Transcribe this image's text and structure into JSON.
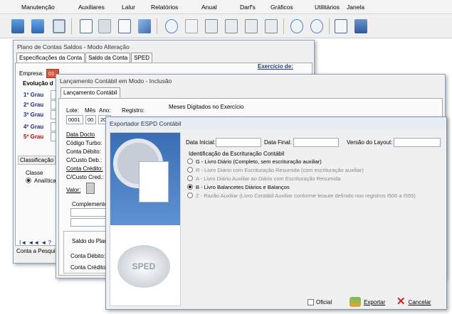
{
  "menu": [
    {
      "label": "Manutenção"
    },
    {
      "label": "Auxiliares"
    },
    {
      "label": "Lalur"
    },
    {
      "label": "Relatórios"
    },
    {
      "label": "Anual"
    },
    {
      "label": "Darf's"
    },
    {
      "label": "Gráficos"
    },
    {
      "label": "Utilitários"
    },
    {
      "label": "Janela"
    }
  ],
  "toolbar": [
    {
      "icon": "import-icon",
      "color": "#3f78c4"
    },
    {
      "icon": "users-icon",
      "color": "#3f78c4"
    },
    {
      "icon": "window-icon",
      "color": "#7a8fa8"
    },
    {
      "icon": "document-edit-icon",
      "color": "#4b6fa0"
    },
    {
      "icon": "calculator-icon",
      "color": "#8ea1b6"
    },
    {
      "icon": "percent-icon",
      "color": "#4b6fa0"
    },
    {
      "icon": "pencil-icon",
      "color": "#5c7fb3"
    },
    {
      "icon": "zoom-icon",
      "color": "#5c7fb3"
    },
    {
      "icon": "page-icon",
      "color": "#9aa7b4"
    },
    {
      "icon": "report-icon",
      "color": "#7b8a99"
    },
    {
      "icon": "report-2-icon",
      "color": "#7b8a99"
    },
    {
      "icon": "report-3-icon",
      "color": "#7b8a99"
    },
    {
      "icon": "report-4-icon",
      "color": "#7b8a99"
    },
    {
      "icon": "preview-icon",
      "color": "#5c7fb3"
    },
    {
      "icon": "preview-2-icon",
      "color": "#5c7fb3"
    },
    {
      "icon": "book-icon",
      "color": "#4a6a9e"
    },
    {
      "icon": "exit-icon",
      "color": "#4a6a9e"
    }
  ],
  "plano": {
    "title": "Plano de Contas Saldos - Modo Alteração",
    "tabs": [
      "Especificações da Conta",
      "Saldo da Conta",
      "SPED"
    ],
    "empresa_label": "Empresa:",
    "empresa_value": "01",
    "evolucao_label": "Evolução d",
    "exercicio_label": "Exercício de:",
    "graus": [
      "1º Grau",
      "2º Grau",
      "3º Grau",
      "4º Grau",
      "5º Grau"
    ],
    "classificacao_label": "Classificação",
    "classe_label": "Classe",
    "classe_option": "Analítica",
    "nav_label": "I◄ ◄◄ ◄ ?",
    "status": "Conta a Pesquis"
  },
  "lancamento": {
    "title": "Lançamento Contábil em Modo - Inclusão",
    "tab": "Lançamento Contábil",
    "lote_label": "Lote:",
    "mes_label": "Mês",
    "ano_label": "Ano:",
    "registro_label": "Registro:",
    "lote_value": "0001",
    "mes_value": "00",
    "ano_value": "20",
    "meses_label": "Meses Digitados no Exercício",
    "fields": [
      "Data Docto",
      "Código Turbo:",
      "Conta Débito:",
      "C/Custo Deb.:",
      "Conta Crédito:",
      "C/Custo Cred.:"
    ],
    "valor_label": "Valor:",
    "complemento_label": "Complemento",
    "saldo_label": "Saldo do Plano",
    "conta_debito": "Conta Débito:",
    "conta_credito": "Conta Crédito:"
  },
  "exportador": {
    "title": "Exportador ESPD Contábil",
    "data_inicial_label": "Data Inicial:",
    "data_final_label": "Data Final:",
    "versao_label": "Versão do Layout:",
    "identificacao_label": "Identificação da Escrituração Contábil",
    "options": [
      {
        "text": "G - Livro Diário (Completo, sem escrituração auxiliar)",
        "enabled": true,
        "selected": false
      },
      {
        "text": "R - Livro Diário com Escrituração Resumida (com escrituração auxiliar)",
        "enabled": false,
        "selected": false
      },
      {
        "text": "A - Livro Diário Auxiliar ao Diário com Escrituração Resumida",
        "enabled": false,
        "selected": false
      },
      {
        "text": "B - Livro Balancetes Diários e Balanços",
        "enabled": true,
        "selected": true
      },
      {
        "text": "Z - Razão Auxiliar (Livro Contábil Auxiliar conforme leiaute definido nos registros I500 a I555)",
        "enabled": false,
        "selected": false
      }
    ],
    "sped_logo_text": "SPED",
    "oficial_label": "Oficial",
    "exportar_label": "Exportar",
    "cancelar_label": "Cancelar"
  },
  "colors": {
    "accent": "#3f78c4",
    "required": "#c00000",
    "dialog_border": "#8ca0b8"
  }
}
